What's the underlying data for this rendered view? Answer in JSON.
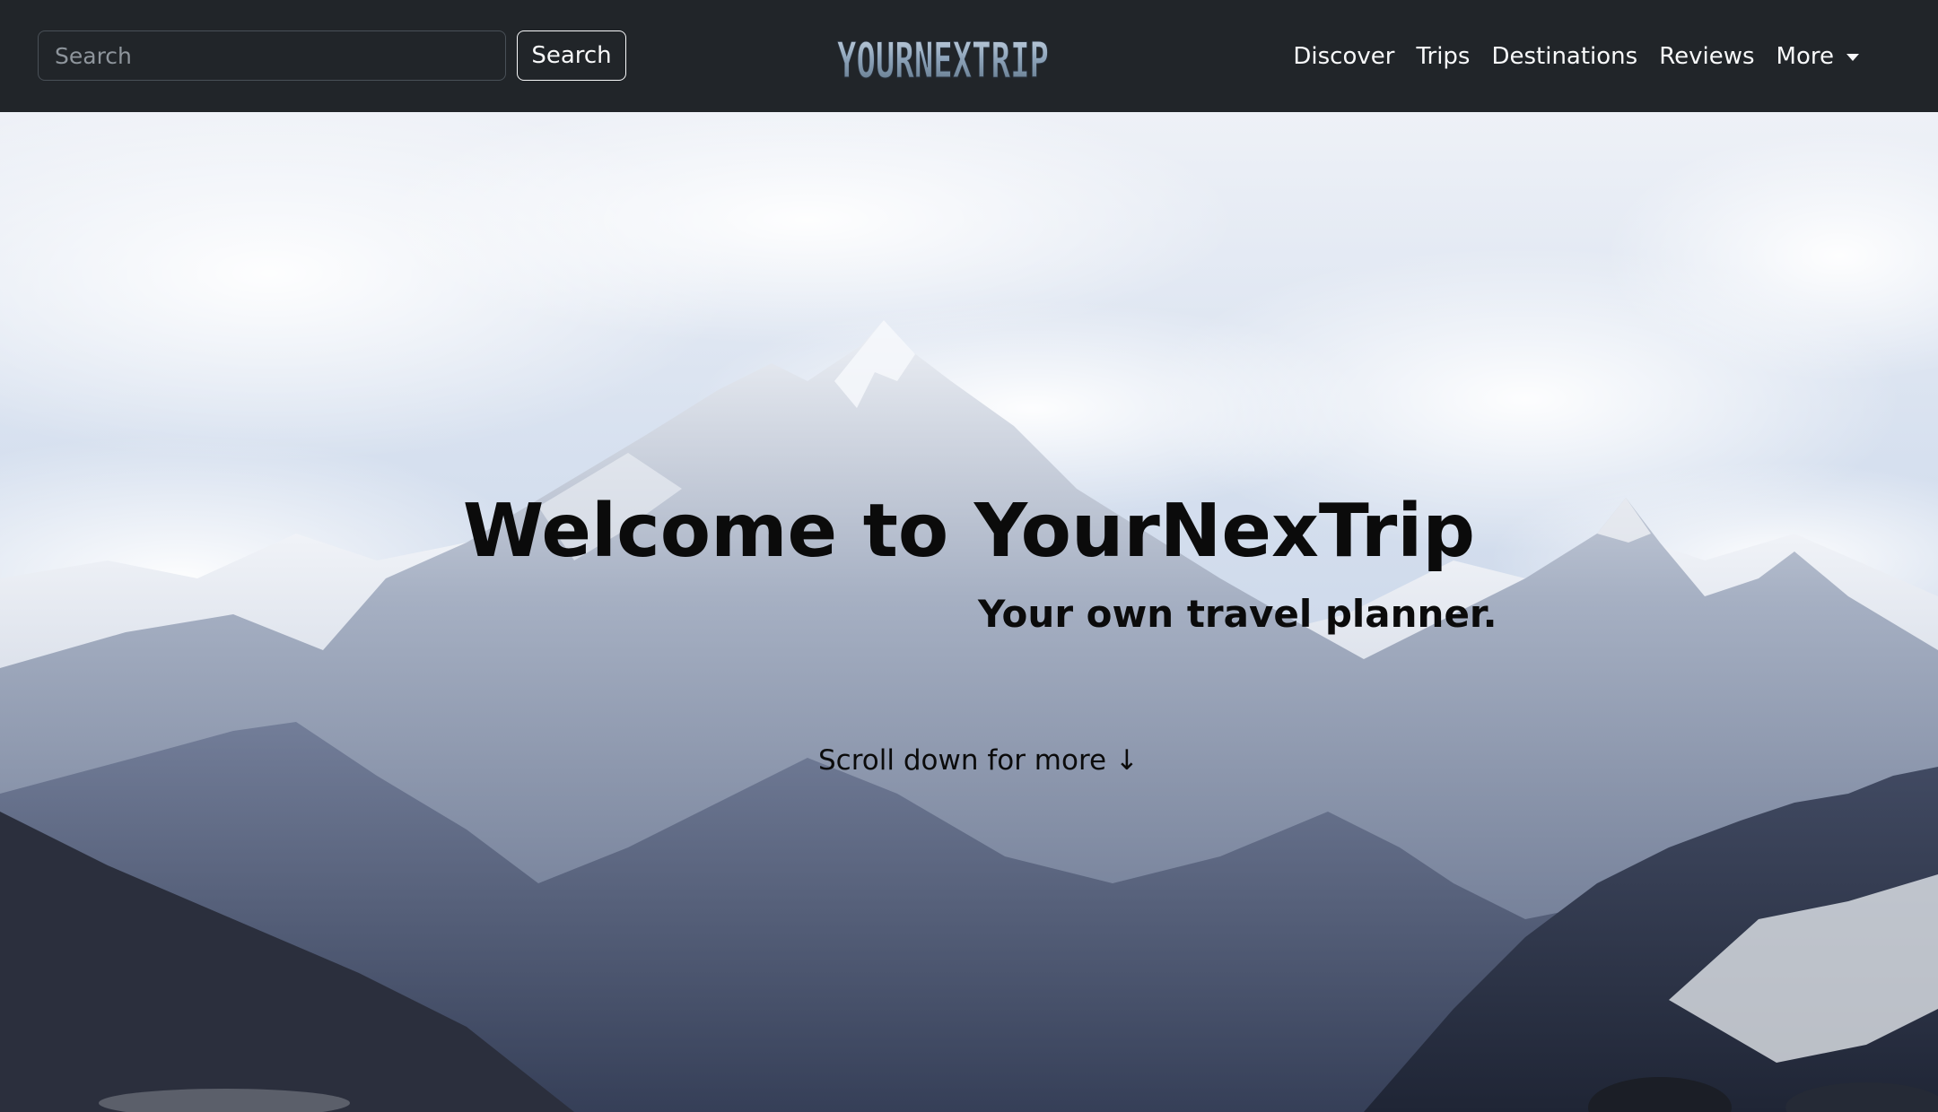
{
  "navbar": {
    "search": {
      "placeholder": "Search",
      "button_label": "Search"
    },
    "brand": {
      "logo_text": "YOURNEXTRIP",
      "logo_icon": "logo-icon"
    },
    "links": [
      {
        "label": "Discover"
      },
      {
        "label": "Trips"
      },
      {
        "label": "Destinations"
      },
      {
        "label": "Reviews"
      }
    ],
    "more_label": "More",
    "more_icon": "caret-down-icon"
  },
  "hero": {
    "title": "Welcome to YourNexTrip",
    "subtitle": "Your own travel planner.",
    "scroll_hint": "Scroll down for more ↓"
  },
  "colors": {
    "navbar_bg": "#212529",
    "nav_text": "#f8f9fa",
    "hero_text": "#0b0b0b"
  }
}
